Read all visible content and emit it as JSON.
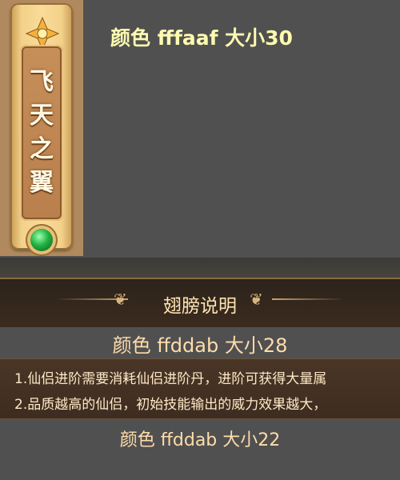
{
  "side_panel": {
    "title": "飞天之翼",
    "icons": [
      "lotus-icon",
      "gem-icon"
    ]
  },
  "captions": {
    "top": "颜色  fffaaf  大小30",
    "middle": "颜色  ffddab  大小28",
    "bottom": "颜色  ffddab  大小22"
  },
  "section": {
    "title": "翅膀说明"
  },
  "description": {
    "lines": [
      "1.仙侣进阶需要消耗仙侣进阶丹，进阶可获得大量属",
      "2.品质越高的仙侣，初始技能输出的威力效果越大，"
    ]
  },
  "colors": {
    "caption_top": "#fffaaf",
    "caption_other": "#ffddab",
    "background": "#505050"
  }
}
